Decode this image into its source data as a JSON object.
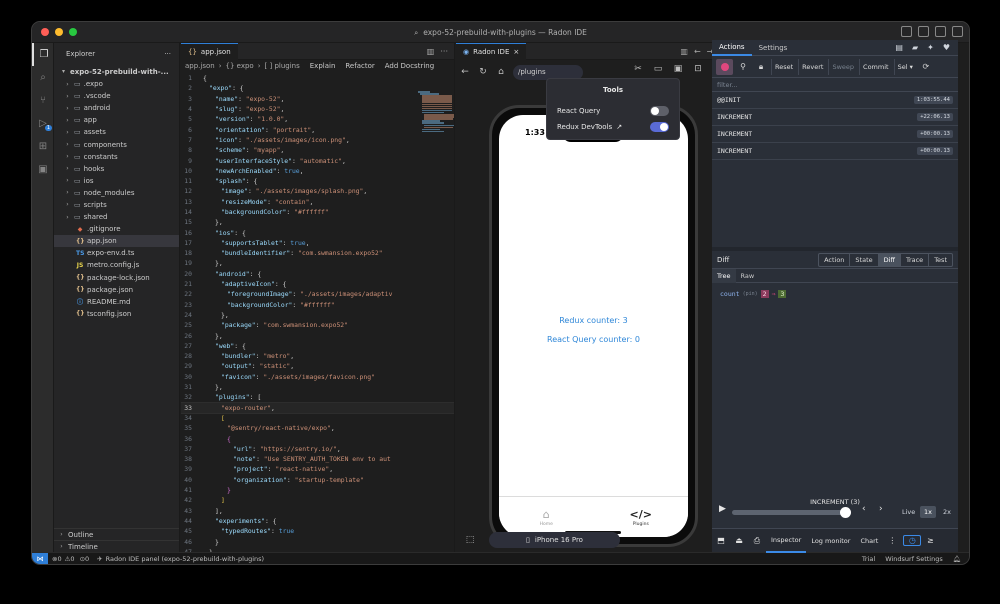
{
  "window": {
    "title": "expo-52-prebuild-with-plugins — Radon IDE"
  },
  "explorer": {
    "title": "Explorer",
    "root": "expo-52-prebuild-with-...",
    "items": [
      {
        "label": ".expo",
        "type": "folder"
      },
      {
        "label": ".vscode",
        "type": "folder"
      },
      {
        "label": "android",
        "type": "folder"
      },
      {
        "label": "app",
        "type": "folder"
      },
      {
        "label": "assets",
        "type": "folder"
      },
      {
        "label": "components",
        "type": "folder"
      },
      {
        "label": "constants",
        "type": "folder"
      },
      {
        "label": "hooks",
        "type": "folder"
      },
      {
        "label": "ios",
        "type": "folder"
      },
      {
        "label": "node_modules",
        "type": "folder"
      },
      {
        "label": "scripts",
        "type": "folder"
      },
      {
        "label": "shared",
        "type": "folder"
      },
      {
        "label": ".gitignore",
        "type": "git"
      },
      {
        "label": "app.json",
        "type": "json",
        "selected": true
      },
      {
        "label": "expo-env.d.ts",
        "type": "ts"
      },
      {
        "label": "metro.config.js",
        "type": "js"
      },
      {
        "label": "package-lock.json",
        "type": "json"
      },
      {
        "label": "package.json",
        "type": "json"
      },
      {
        "label": "README.md",
        "type": "md"
      },
      {
        "label": "tsconfig.json",
        "type": "json"
      }
    ],
    "outline": "Outline",
    "timeline": "Timeline"
  },
  "editor": {
    "tab": "app.json",
    "crumbs": [
      "app.json",
      "{} expo",
      "[ ] plugins"
    ],
    "codelens": [
      "Explain",
      "Refactor",
      "Add Docstring"
    ],
    "current_line": 33,
    "lines": [
      {
        "n": 1,
        "indent": 0,
        "t": [
          [
            "{",
            "p"
          ]
        ]
      },
      {
        "n": 2,
        "indent": 1,
        "t": [
          [
            "\"expo\"",
            "k"
          ],
          [
            ": {",
            "p"
          ]
        ]
      },
      {
        "n": 3,
        "indent": 2,
        "t": [
          [
            "\"name\"",
            "k"
          ],
          [
            ": ",
            "p"
          ],
          [
            "\"expo-52\"",
            "s"
          ],
          [
            ",",
            "p"
          ]
        ]
      },
      {
        "n": 4,
        "indent": 2,
        "t": [
          [
            "\"slug\"",
            "k"
          ],
          [
            ": ",
            "p"
          ],
          [
            "\"expo-52\"",
            "s"
          ],
          [
            ",",
            "p"
          ]
        ]
      },
      {
        "n": 5,
        "indent": 2,
        "t": [
          [
            "\"version\"",
            "k"
          ],
          [
            ": ",
            "p"
          ],
          [
            "\"1.0.0\"",
            "s"
          ],
          [
            ",",
            "p"
          ]
        ]
      },
      {
        "n": 6,
        "indent": 2,
        "t": [
          [
            "\"orientation\"",
            "k"
          ],
          [
            ": ",
            "p"
          ],
          [
            "\"portrait\"",
            "s"
          ],
          [
            ",",
            "p"
          ]
        ]
      },
      {
        "n": 7,
        "indent": 2,
        "t": [
          [
            "\"icon\"",
            "k"
          ],
          [
            ": ",
            "p"
          ],
          [
            "\"./assets/images/icon.png\"",
            "s"
          ],
          [
            ",",
            "p"
          ]
        ]
      },
      {
        "n": 8,
        "indent": 2,
        "t": [
          [
            "\"scheme\"",
            "k"
          ],
          [
            ": ",
            "p"
          ],
          [
            "\"myapp\"",
            "s"
          ],
          [
            ",",
            "p"
          ]
        ]
      },
      {
        "n": 9,
        "indent": 2,
        "t": [
          [
            "\"userInterfaceStyle\"",
            "k"
          ],
          [
            ": ",
            "p"
          ],
          [
            "\"automatic\"",
            "s"
          ],
          [
            ",",
            "p"
          ]
        ]
      },
      {
        "n": 10,
        "indent": 2,
        "t": [
          [
            "\"newArchEnabled\"",
            "k"
          ],
          [
            ": ",
            "p"
          ],
          [
            "true",
            "b"
          ],
          [
            ",",
            "p"
          ]
        ]
      },
      {
        "n": 11,
        "indent": 2,
        "t": [
          [
            "\"splash\"",
            "k"
          ],
          [
            ": {",
            "p"
          ]
        ]
      },
      {
        "n": 12,
        "indent": 3,
        "t": [
          [
            "\"image\"",
            "k"
          ],
          [
            ": ",
            "p"
          ],
          [
            "\"./assets/images/splash.png\"",
            "s"
          ],
          [
            ",",
            "p"
          ]
        ]
      },
      {
        "n": 13,
        "indent": 3,
        "t": [
          [
            "\"resizeMode\"",
            "k"
          ],
          [
            ": ",
            "p"
          ],
          [
            "\"contain\"",
            "s"
          ],
          [
            ",",
            "p"
          ]
        ]
      },
      {
        "n": 14,
        "indent": 3,
        "t": [
          [
            "\"backgroundColor\"",
            "k"
          ],
          [
            ": ",
            "p"
          ],
          [
            "\"#ffffff\"",
            "s"
          ]
        ]
      },
      {
        "n": 15,
        "indent": 2,
        "t": [
          [
            "},",
            "p"
          ]
        ]
      },
      {
        "n": 16,
        "indent": 2,
        "t": [
          [
            "\"ios\"",
            "k"
          ],
          [
            ": {",
            "p"
          ]
        ]
      },
      {
        "n": 17,
        "indent": 3,
        "t": [
          [
            "\"supportsTablet\"",
            "k"
          ],
          [
            ": ",
            "p"
          ],
          [
            "true",
            "b"
          ],
          [
            ",",
            "p"
          ]
        ]
      },
      {
        "n": 18,
        "indent": 3,
        "t": [
          [
            "\"bundleIdentifier\"",
            "k"
          ],
          [
            ": ",
            "p"
          ],
          [
            "\"com.swmansion.expo52\"",
            "s"
          ]
        ]
      },
      {
        "n": 19,
        "indent": 2,
        "t": [
          [
            "},",
            "p"
          ]
        ]
      },
      {
        "n": 20,
        "indent": 2,
        "t": [
          [
            "\"android\"",
            "k"
          ],
          [
            ": {",
            "p"
          ]
        ]
      },
      {
        "n": 21,
        "indent": 3,
        "t": [
          [
            "\"adaptiveIcon\"",
            "k"
          ],
          [
            ": {",
            "p"
          ]
        ]
      },
      {
        "n": 22,
        "indent": 4,
        "t": [
          [
            "\"foregroundImage\"",
            "k"
          ],
          [
            ": ",
            "p"
          ],
          [
            "\"./assets/images/adaptiv",
            "s"
          ]
        ]
      },
      {
        "n": 23,
        "indent": 4,
        "t": [
          [
            "\"backgroundColor\"",
            "k"
          ],
          [
            ": ",
            "p"
          ],
          [
            "\"#ffffff\"",
            "s"
          ]
        ]
      },
      {
        "n": 24,
        "indent": 3,
        "t": [
          [
            "},",
            "p"
          ]
        ]
      },
      {
        "n": 25,
        "indent": 3,
        "t": [
          [
            "\"package\"",
            "k"
          ],
          [
            ": ",
            "p"
          ],
          [
            "\"com.swmansion.expo52\"",
            "s"
          ]
        ]
      },
      {
        "n": 26,
        "indent": 2,
        "t": [
          [
            "},",
            "p"
          ]
        ]
      },
      {
        "n": 27,
        "indent": 2,
        "t": [
          [
            "\"web\"",
            "k"
          ],
          [
            ": {",
            "p"
          ]
        ]
      },
      {
        "n": 28,
        "indent": 3,
        "t": [
          [
            "\"bundler\"",
            "k"
          ],
          [
            ": ",
            "p"
          ],
          [
            "\"metro\"",
            "s"
          ],
          [
            ",",
            "p"
          ]
        ]
      },
      {
        "n": 29,
        "indent": 3,
        "t": [
          [
            "\"output\"",
            "k"
          ],
          [
            ": ",
            "p"
          ],
          [
            "\"static\"",
            "s"
          ],
          [
            ",",
            "p"
          ]
        ]
      },
      {
        "n": 30,
        "indent": 3,
        "t": [
          [
            "\"favicon\"",
            "k"
          ],
          [
            ": ",
            "p"
          ],
          [
            "\"./assets/images/favicon.png\"",
            "s"
          ]
        ]
      },
      {
        "n": 31,
        "indent": 2,
        "t": [
          [
            "},",
            "p"
          ]
        ]
      },
      {
        "n": 32,
        "indent": 2,
        "t": [
          [
            "\"plugins\"",
            "k"
          ],
          [
            ": [",
            "p"
          ]
        ]
      },
      {
        "n": 33,
        "indent": 3,
        "t": [
          [
            "\"expo-router\"",
            "s"
          ],
          [
            ",",
            "p"
          ]
        ]
      },
      {
        "n": 34,
        "indent": 3,
        "t": [
          [
            "[",
            "y"
          ]
        ]
      },
      {
        "n": 35,
        "indent": 4,
        "t": [
          [
            "\"@sentry/react-native/expo\"",
            "s"
          ],
          [
            ",",
            "p"
          ]
        ]
      },
      {
        "n": 36,
        "indent": 4,
        "t": [
          [
            "{",
            "m"
          ]
        ]
      },
      {
        "n": 37,
        "indent": 5,
        "t": [
          [
            "\"url\"",
            "k"
          ],
          [
            ": ",
            "p"
          ],
          [
            "\"https://sentry.io/\"",
            "s"
          ],
          [
            ",",
            "p"
          ]
        ]
      },
      {
        "n": 38,
        "indent": 5,
        "t": [
          [
            "\"note\"",
            "k"
          ],
          [
            ": ",
            "p"
          ],
          [
            "\"Use SENTRY_AUTH_TOKEN env to aut",
            "s"
          ]
        ]
      },
      {
        "n": 39,
        "indent": 5,
        "t": [
          [
            "\"project\"",
            "k"
          ],
          [
            ": ",
            "p"
          ],
          [
            "\"react-native\"",
            "s"
          ],
          [
            ",",
            "p"
          ]
        ]
      },
      {
        "n": 40,
        "indent": 5,
        "t": [
          [
            "\"organization\"",
            "k"
          ],
          [
            ": ",
            "p"
          ],
          [
            "\"startup-template\"",
            "s"
          ]
        ]
      },
      {
        "n": 41,
        "indent": 4,
        "t": [
          [
            "}",
            "m"
          ]
        ]
      },
      {
        "n": 42,
        "indent": 3,
        "t": [
          [
            "]",
            "y"
          ]
        ]
      },
      {
        "n": 43,
        "indent": 2,
        "t": [
          [
            "],",
            "p"
          ]
        ]
      },
      {
        "n": 44,
        "indent": 2,
        "t": [
          [
            "\"experiments\"",
            "k"
          ],
          [
            ": {",
            "p"
          ]
        ]
      },
      {
        "n": 45,
        "indent": 3,
        "t": [
          [
            "\"typedRoutes\"",
            "k"
          ],
          [
            ": ",
            "p"
          ],
          [
            "true",
            "b"
          ]
        ]
      },
      {
        "n": 46,
        "indent": 2,
        "t": [
          [
            "}",
            "p"
          ]
        ]
      },
      {
        "n": 47,
        "indent": 1,
        "t": [
          [
            "}",
            "p"
          ]
        ]
      },
      {
        "n": 48,
        "indent": 0,
        "t": [
          [
            "}",
            "p"
          ]
        ]
      },
      {
        "n": 49,
        "indent": 0,
        "t": []
      }
    ]
  },
  "radon": {
    "tab": "Radon IDE",
    "url": "/plugins",
    "clock": "1:33",
    "redux_counter": "Redux counter: 3",
    "query_counter": "React Query counter: 0",
    "tabs": [
      {
        "label": "Home",
        "active": false
      },
      {
        "label": "Plugins",
        "active": true
      }
    ],
    "device": "iPhone 16 Pro",
    "tools": {
      "title": "Tools",
      "items": [
        {
          "label": "React Query",
          "enabled": false
        },
        {
          "label": "Redux DevTools",
          "enabled": true
        }
      ]
    }
  },
  "redux": {
    "tabs": [
      "Actions",
      "Settings"
    ],
    "buttons": [
      "Reset",
      "Revert",
      "Sweep",
      "Commit"
    ],
    "sel": "Sel",
    "filter_placeholder": "filter...",
    "actions": [
      {
        "name": "@@INIT",
        "time": "1:03:55.44"
      },
      {
        "name": "INCREMENT",
        "time": "+22:06.13"
      },
      {
        "name": "INCREMENT",
        "time": "+00:00.13"
      },
      {
        "name": "INCREMENT",
        "time": "+00:00.13"
      }
    ],
    "diff_label": "Diff",
    "diff_tabs": [
      "Action",
      "State",
      "Diff",
      "Trace",
      "Test"
    ],
    "diff_active": "Diff",
    "sub_tabs": [
      "Tree",
      "Raw"
    ],
    "diff": {
      "key": "count",
      "sub": "(pin)",
      "old": "2",
      "arrow": "⇒",
      "new": "3"
    },
    "slider": {
      "label": "INCREMENT",
      "count": "(3)",
      "live": "Live",
      "speeds": [
        "1x",
        "2x"
      ],
      "position": 0.95
    },
    "footer_tabs": [
      "Inspector",
      "Log monitor",
      "Chart"
    ],
    "footer_active": "Inspector"
  },
  "statusbar": {
    "problems": "0",
    "warnings": "0",
    "ports": "0",
    "panel": "Radon IDE panel (expo-52-prebuild-with-plugins)",
    "trial": "Trial",
    "settings": "Windsurf Settings"
  },
  "colors": {
    "accent": "#2f7fd8",
    "key": "#9cdcfe",
    "string": "#ce9178",
    "bool": "#569cd6",
    "counter": "#2f87d8",
    "toggle_on": "#5a6bd6"
  }
}
